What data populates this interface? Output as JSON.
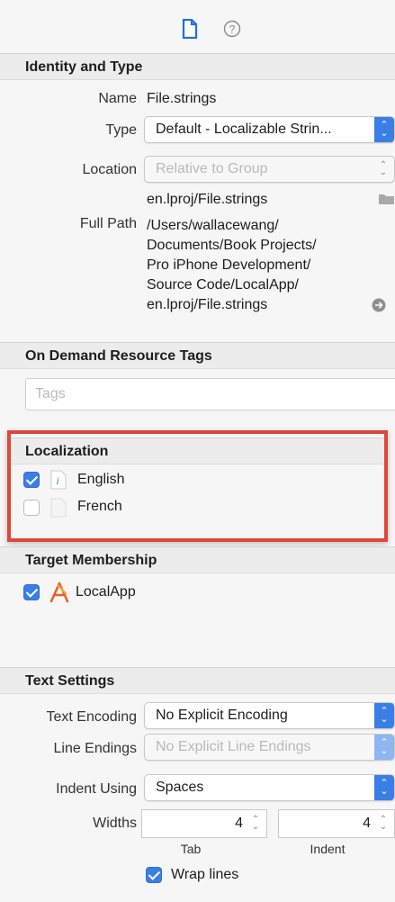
{
  "toolbar": {
    "file_icon": "file-icon",
    "help_icon": "help-icon"
  },
  "identity": {
    "header": "Identity and Type",
    "name_label": "Name",
    "name_value": "File.strings",
    "type_label": "Type",
    "type_value": "Default - Localizable Strin...",
    "location_label": "Location",
    "location_value": "Relative to Group",
    "location_path": "en.lproj/File.strings",
    "fullpath_label": "Full Path",
    "fullpath_lines": [
      "/Users/wallacewang/",
      "Documents/Book Projects/",
      "Pro iPhone Development/",
      "Source Code/LocalApp/",
      "en.lproj/File.strings"
    ]
  },
  "ondemand": {
    "header": "On Demand Resource Tags",
    "tags_placeholder": "Tags"
  },
  "localization": {
    "header": "Localization",
    "items": [
      {
        "label": "English",
        "checked": true
      },
      {
        "label": "French",
        "checked": false
      }
    ]
  },
  "target": {
    "header": "Target Membership",
    "item_label": "LocalApp",
    "checked": true
  },
  "text_settings": {
    "header": "Text Settings",
    "encoding_label": "Text Encoding",
    "encoding_value": "No Explicit Encoding",
    "line_endings_label": "Line Endings",
    "line_endings_value": "No Explicit Line Endings",
    "indent_using_label": "Indent Using",
    "indent_using_value": "Spaces",
    "widths_label": "Widths",
    "tab_value": "4",
    "indent_value": "4",
    "tab_label": "Tab",
    "indent_label": "Indent",
    "wrap_label": "Wrap lines",
    "wrap_checked": true
  },
  "colors": {
    "accent": "#3a7fe6",
    "highlight": "#e0463a"
  }
}
